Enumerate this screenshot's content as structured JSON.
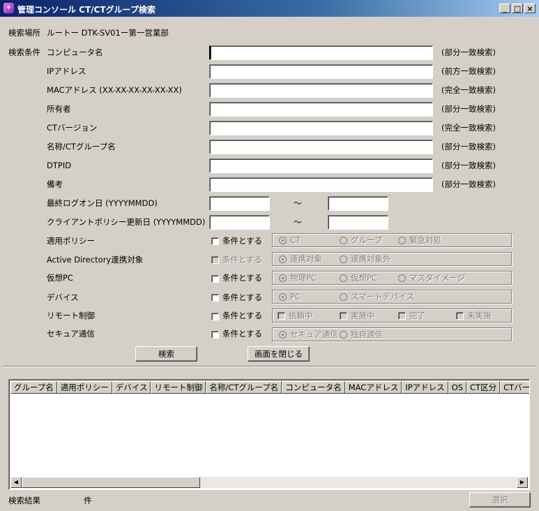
{
  "window": {
    "title": "管理コンソール CT/CTグループ検索",
    "min": "_",
    "max": "□",
    "close": "×"
  },
  "location": {
    "label": "検索場所",
    "path": "ルートー DTK-SV01ー第一営業部"
  },
  "conditions": {
    "label": "検索条件",
    "fields": [
      {
        "label": "コンピュータ名",
        "hint": "(部分一致検索)",
        "value": ""
      },
      {
        "label": "IPアドレス",
        "hint": "(前方一致検索)",
        "value": ""
      },
      {
        "label": "MACアドレス (XX-XX-XX-XX-XX-XX)",
        "hint": "(完全一致検索)",
        "value": ""
      },
      {
        "label": "所有者",
        "hint": "(部分一致検索)",
        "value": ""
      },
      {
        "label": "CTバージョン",
        "hint": "(完全一致検索)",
        "value": ""
      },
      {
        "label": "名称/CTグループ名",
        "hint": "(部分一致検索)",
        "value": ""
      },
      {
        "label": "DTPID",
        "hint": "(部分一致検索)",
        "value": ""
      },
      {
        "label": "備考",
        "hint": "(部分一致検索)",
        "value": ""
      }
    ],
    "ranges": [
      {
        "label": "最終ログオン日 (YYYYMMDD)",
        "sep": "～",
        "from": "",
        "to": ""
      },
      {
        "label": "クライアントポリシー更新日 (YYYYMMDD)",
        "sep": "～",
        "from": "",
        "to": ""
      }
    ],
    "checkbox_label": "条件とする",
    "options": [
      {
        "label": "適用ポリシー",
        "items": [
          "CT",
          "グループ",
          "緊急対処"
        ]
      },
      {
        "label": "Active Directory連携対象",
        "items": [
          "連携対象",
          "連携対象外"
        ]
      },
      {
        "label": "仮想PC",
        "items": [
          "物理PC",
          "仮想PC",
          "マスタイメージ"
        ]
      },
      {
        "label": "デバイス",
        "items": [
          "PC",
          "スマートデバイス"
        ]
      },
      {
        "label": "リモート制御",
        "items": [
          "依頼中",
          "実施中",
          "完了",
          "未実施"
        ]
      },
      {
        "label": "セキュア通信",
        "items": [
          "セキュア通信",
          "独自通信"
        ]
      }
    ]
  },
  "buttons": {
    "search": "検索",
    "close": "画面を閉じる",
    "select": "選択"
  },
  "results": {
    "columns": [
      "グループ名",
      "適用ポリシー",
      "デバイス",
      "リモート制御",
      "名称/CTグループ名",
      "コンピュータ名",
      "MACアドレス",
      "IPアドレス",
      "OS",
      "CT区分",
      "CTバー"
    ],
    "count_label": "検索結果",
    "count_unit": "件"
  }
}
